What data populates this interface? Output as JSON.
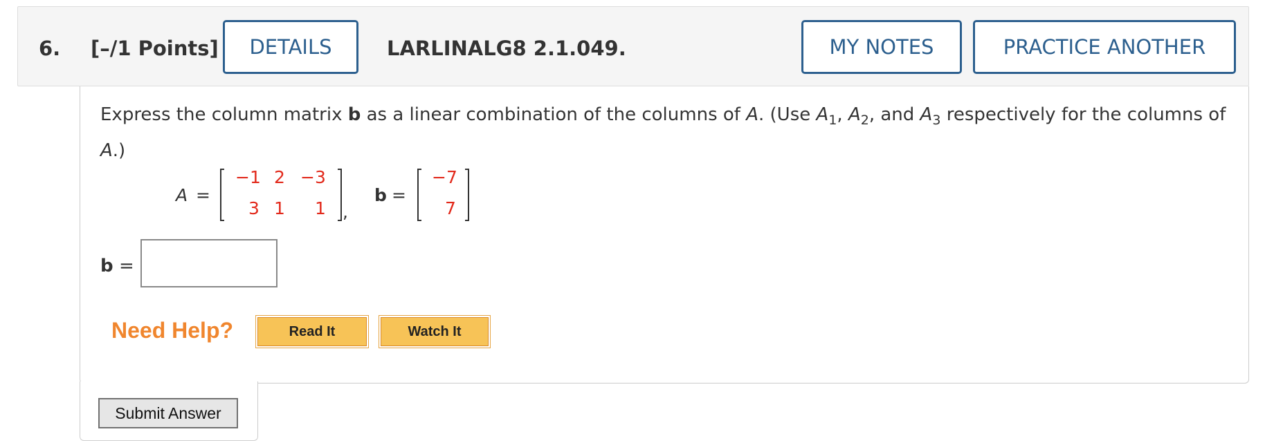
{
  "header": {
    "number": "6.",
    "points": "[–/1 Points]",
    "details_label": "DETAILS",
    "problem_code": "LARLINALG8 2.1.049.",
    "my_notes_label": "MY NOTES",
    "practice_label": "PRACTICE ANOTHER"
  },
  "question": {
    "text_1": "Express the column matrix ",
    "text_b": "b",
    "text_2": " as a linear combination of the columns of ",
    "text_A": "A",
    "text_3": ". (Use ",
    "a1": "A",
    "a1_sub": "1",
    "sep1": ", ",
    "a2": "A",
    "a2_sub": "2",
    "sep2": ", and ",
    "a3": "A",
    "a3_sub": "3",
    "text_4": " respectively for the columns of ",
    "text_A2": "A",
    "text_5": ".)"
  },
  "matrix": {
    "A_label": "A",
    "equals": "=",
    "A_rows": [
      [
        "−1",
        "2",
        "−3"
      ],
      [
        "3",
        "1",
        "1"
      ]
    ],
    "comma": ",",
    "b_label": "b",
    "b_values": [
      "−7",
      "7"
    ]
  },
  "answer": {
    "label": "b",
    "equals": "=",
    "value": ""
  },
  "help": {
    "label": "Need Help?",
    "read_label": "Read It",
    "watch_label": "Watch It"
  },
  "submit_label": "Submit Answer",
  "colors": {
    "accent": "#2c5f8e",
    "values": "#e2291b",
    "help": "#f0862e",
    "button": "#f7c357"
  }
}
